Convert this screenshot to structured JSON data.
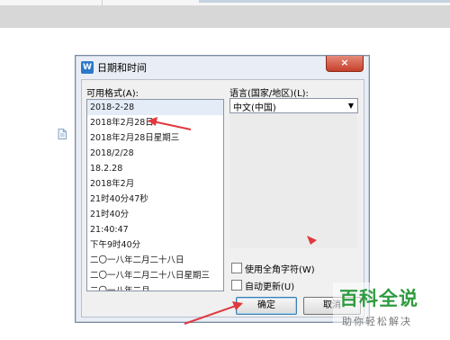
{
  "dialog": {
    "title": "日期和时间",
    "title_icon_letter": "W",
    "close_glyph": "×",
    "formats_label": "可用格式(A):",
    "formats": [
      "2018-2-28",
      "2018年2月28日",
      "2018年2月28日星期三",
      "2018/2/28",
      "18.2.28",
      "2018年2月",
      "21时40分47秒",
      "21时40分",
      "21:40:47",
      "下午9时40分",
      "二〇一八年二月二十八日",
      "二〇一八年二月二十八日星期三",
      "二〇一八年二月"
    ],
    "selected_index": 0,
    "language_label": "语言(国家/地区)(L):",
    "language_value": "中文(中国)",
    "fullwidth_label": "使用全角字符(W)",
    "autoupdate_label": "自动更新(U)",
    "ok_label": "确定",
    "cancel_label": "取消"
  },
  "watermark": {
    "title": "百科全说",
    "subtitle": "助你轻松解决"
  },
  "colors": {
    "annotation_arrow": "#e0393e",
    "watermark_green": "#2f9b3f"
  },
  "icons": {
    "document": "doc-icon",
    "dropdown": "chevron-down-icon"
  }
}
